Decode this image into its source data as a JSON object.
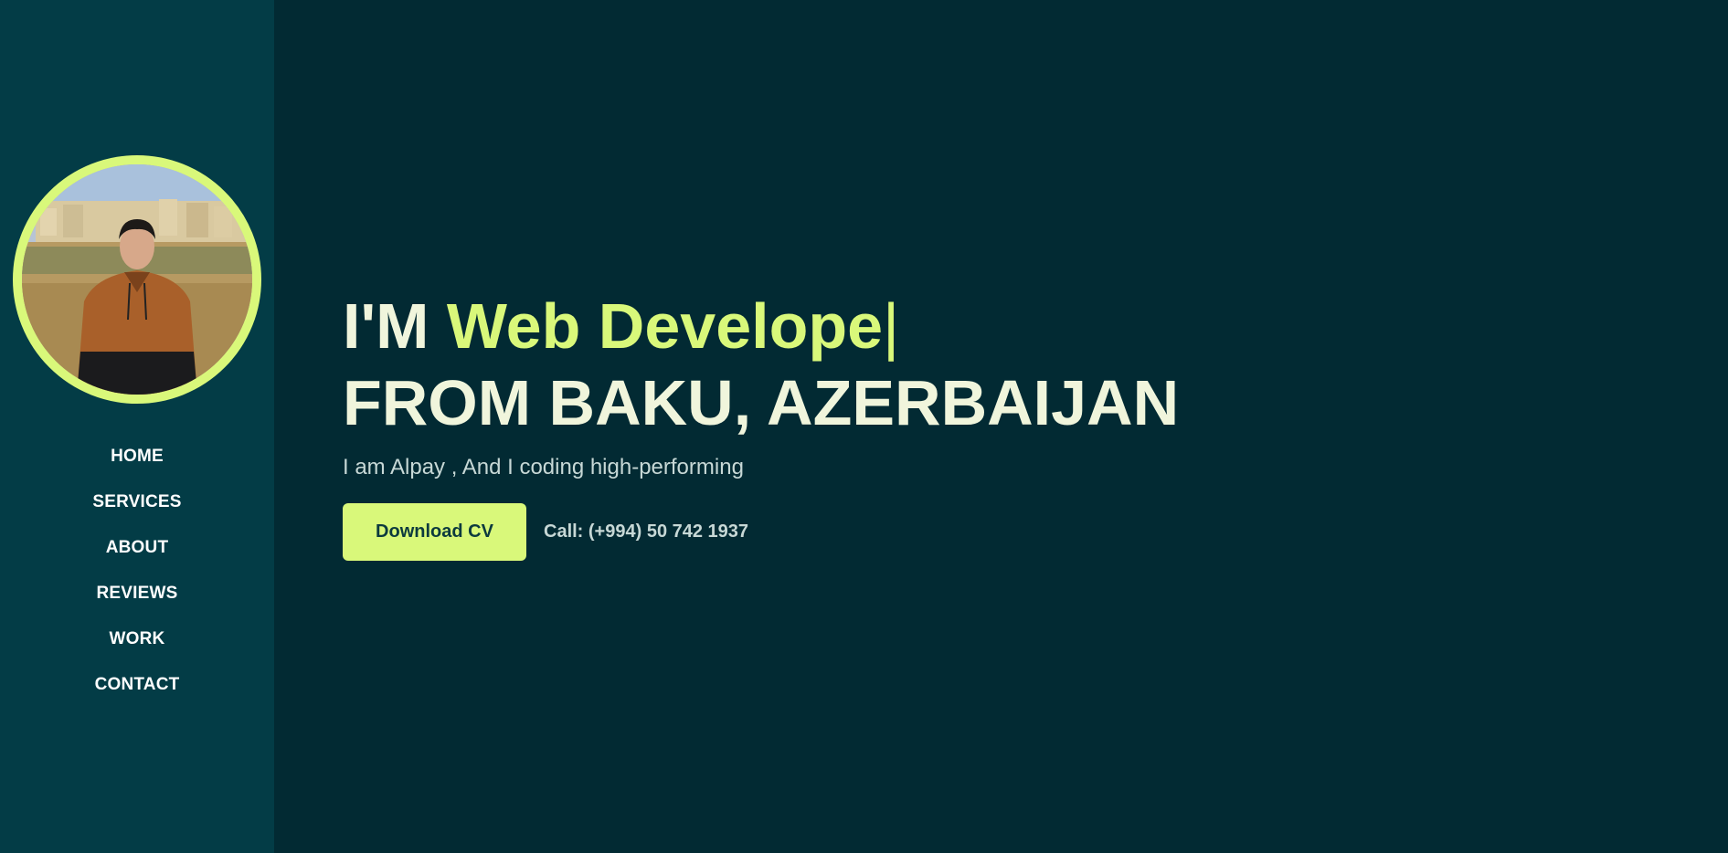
{
  "colors": {
    "page_bg": "#022a33",
    "sidebar_bg": "#033c46",
    "accent": "#d9f87a",
    "heading_text": "#f0f5dc",
    "body_text": "#c7d8d6"
  },
  "profile": {
    "avatar_alt": "Profile photo",
    "avatar_icon": "profile-photo"
  },
  "nav": {
    "items": [
      {
        "label": "HOME"
      },
      {
        "label": "SERVICES"
      },
      {
        "label": "ABOUT"
      },
      {
        "label": "REVIEWS"
      },
      {
        "label": "WORK"
      },
      {
        "label": "CONTACT"
      }
    ]
  },
  "hero": {
    "intro": "I'M",
    "role_typed": "Web Develope",
    "cursor": "|",
    "location": "FROM BAKU, AZERBAIJAN",
    "tagline": "I am Alpay , And I coding high-performing",
    "download_label": "Download CV",
    "call_text": "Call: (+994) 50 742 1937"
  }
}
